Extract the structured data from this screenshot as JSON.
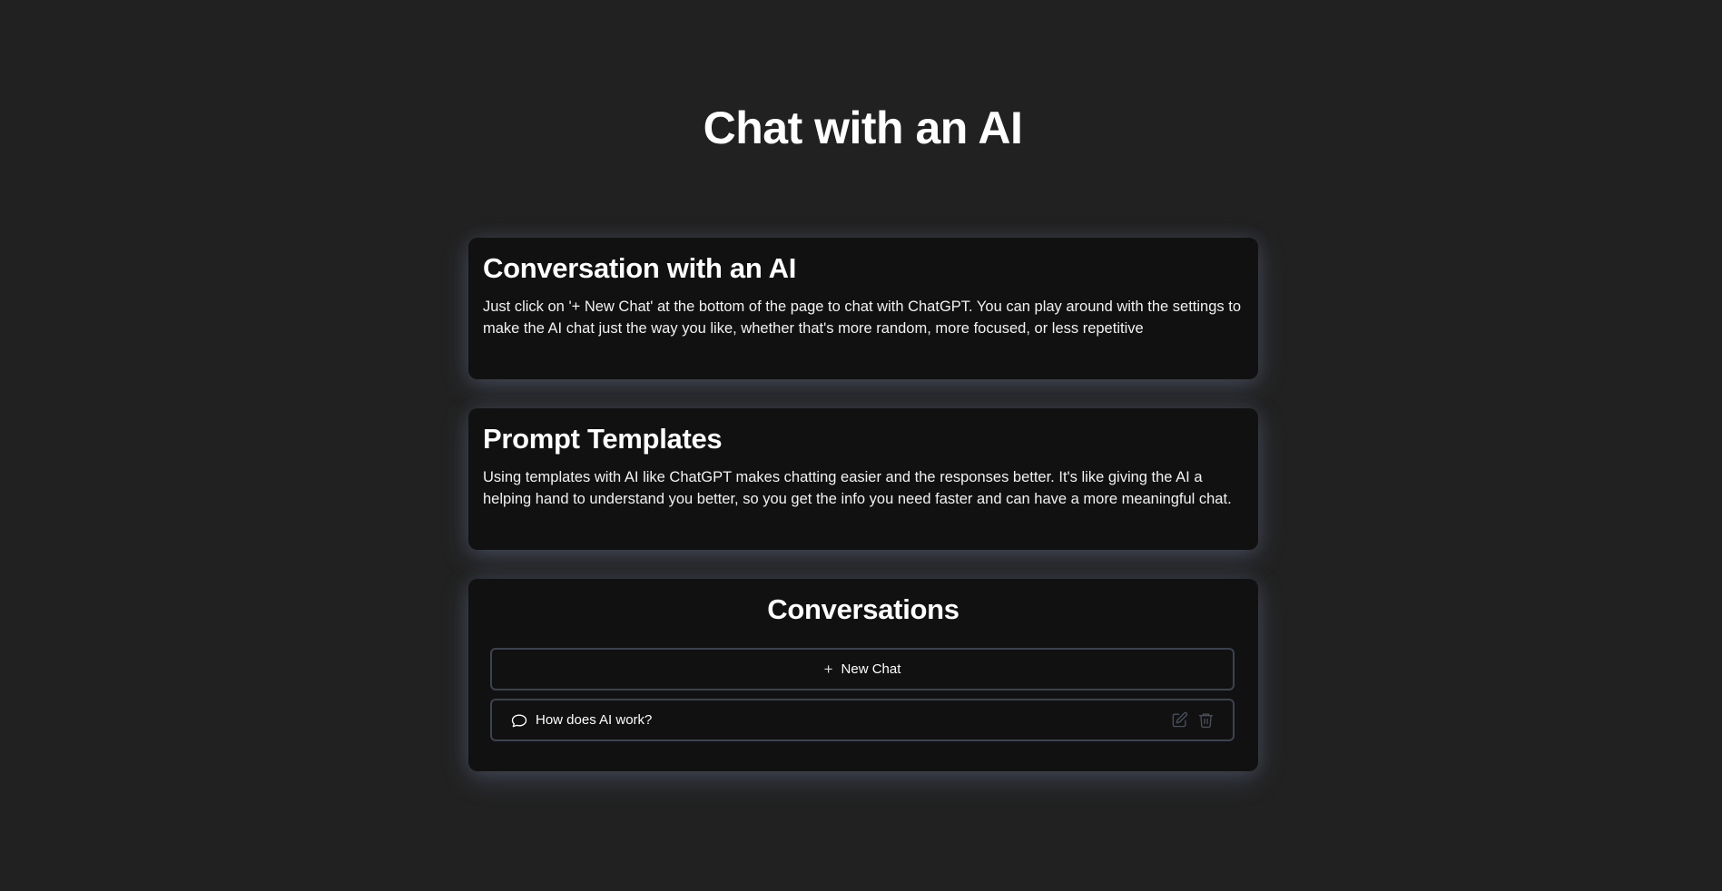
{
  "page": {
    "title": "Chat with an AI"
  },
  "cards": {
    "conversation": {
      "heading": "Conversation with an AI",
      "body": "Just click on '+ New Chat' at the bottom of the page to chat with ChatGPT. You can play around with the settings to make the AI chat just the way you like, whether that's more random, more focused, or less repetitive"
    },
    "templates": {
      "heading": "Prompt Templates",
      "body": "Using templates with AI like ChatGPT makes chatting easier and the responses better. It's like giving the AI a helping hand to understand you better, so you get the info you need faster and can have a more meaningful chat."
    }
  },
  "conversations": {
    "heading": "Conversations",
    "new_chat_label": "New Chat",
    "new_chat_icon": "plus-icon",
    "items": [
      {
        "title": "How does AI work?",
        "icon": "chat-bubble-icon",
        "actions": [
          "edit-icon",
          "trash-icon"
        ]
      }
    ]
  },
  "colors": {
    "background": "#212121",
    "card": "#111111",
    "border": "#3c4250",
    "text": "#ffffff",
    "icon_muted": "#4a4f5c"
  }
}
